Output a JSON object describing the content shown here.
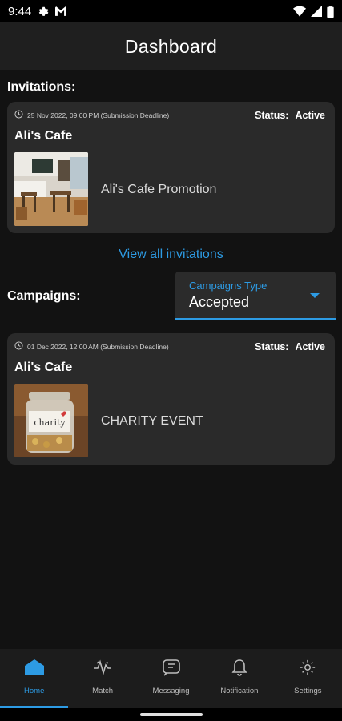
{
  "status_bar": {
    "time": "9:44",
    "left_icons": [
      "gear-icon",
      "gmail-icon"
    ],
    "right_icons": [
      "wifi-icon",
      "signal-icon",
      "battery-icon"
    ]
  },
  "app_bar": {
    "title": "Dashboard"
  },
  "invitations": {
    "label": "Invitations:",
    "card": {
      "deadline": "25 Nov 2022, 09:00 PM (Submission Deadline)",
      "status_label": "Status:",
      "status_value": "Active",
      "name": "Ali's Cafe",
      "promotion": "Ali's Cafe Promotion"
    },
    "view_all": "View all invitations"
  },
  "campaigns": {
    "label": "Campaigns:",
    "dropdown": {
      "label": "Campaigns Type",
      "value": "Accepted"
    },
    "card": {
      "deadline": "01 Dec 2022, 12:00 AM (Submission Deadline)",
      "status_label": "Status:",
      "status_value": "Active",
      "name": "Ali's Cafe",
      "promotion": "CHARITY EVENT"
    }
  },
  "bottom_nav": {
    "items": [
      {
        "label": "Home",
        "icon": "home-icon",
        "active": true
      },
      {
        "label": "Match",
        "icon": "match-icon",
        "active": false
      },
      {
        "label": "Messaging",
        "icon": "messaging-icon",
        "active": false
      },
      {
        "label": "Notification",
        "icon": "bell-icon",
        "active": false
      },
      {
        "label": "Settings",
        "icon": "gear-icon",
        "active": false
      }
    ]
  },
  "colors": {
    "accent": "#2d9be4",
    "background": "#121212",
    "card": "#2a2a2a",
    "appbar": "#1f1f1f"
  }
}
